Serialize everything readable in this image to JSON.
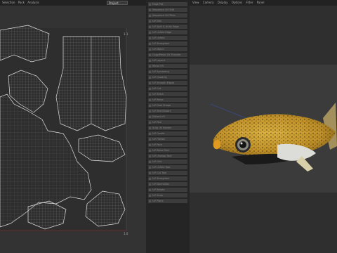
{
  "uv_menu": [
    "Selection",
    "Pack",
    "Analysis"
  ],
  "project_select": "Project",
  "uv_labels": {
    "top_right": "1.1",
    "bottom_right": "1.0"
  },
  "mid_items": [
    "Edge Pat",
    "Sequence UV Edit",
    "Sequence UV Plain",
    "UV Edit",
    "UV Split & Unify Edge",
    "UV Unfold Edge",
    "UV Unfold",
    "UV Straighten",
    "UV Match",
    "Copy/Paste UV Transfer",
    "UV Layout",
    "Mirror UV",
    "UV Symmetry",
    "UV Quadrify",
    "UV Smooth Edges",
    "UV Cut",
    "UV Stitch",
    "UV Relax",
    "UV Dual Shape",
    "UV Sew Distort",
    "Distort UV",
    "UV Peel",
    "Auto UV Border",
    "UV Center",
    "UV Flatten",
    "UV Pack",
    "UV Relax Tool",
    "UV Unwrap Tool",
    "UV Grid",
    "UV Unfold Tool",
    "UV Cut Tool",
    "UV Straighten",
    "UV Normalize",
    "UV Rotate",
    "UV Snap",
    "UV Plane"
  ],
  "vp_menu": [
    "View",
    "Camera",
    "Display",
    "Options",
    "Filter",
    "Panel"
  ],
  "colors": {
    "background": "#2b2b2b",
    "uv_bg": "#333333",
    "viewport_band": "#3b3b3b",
    "fish_body": "#c9a030",
    "fish_spots": "#3a2a10"
  }
}
